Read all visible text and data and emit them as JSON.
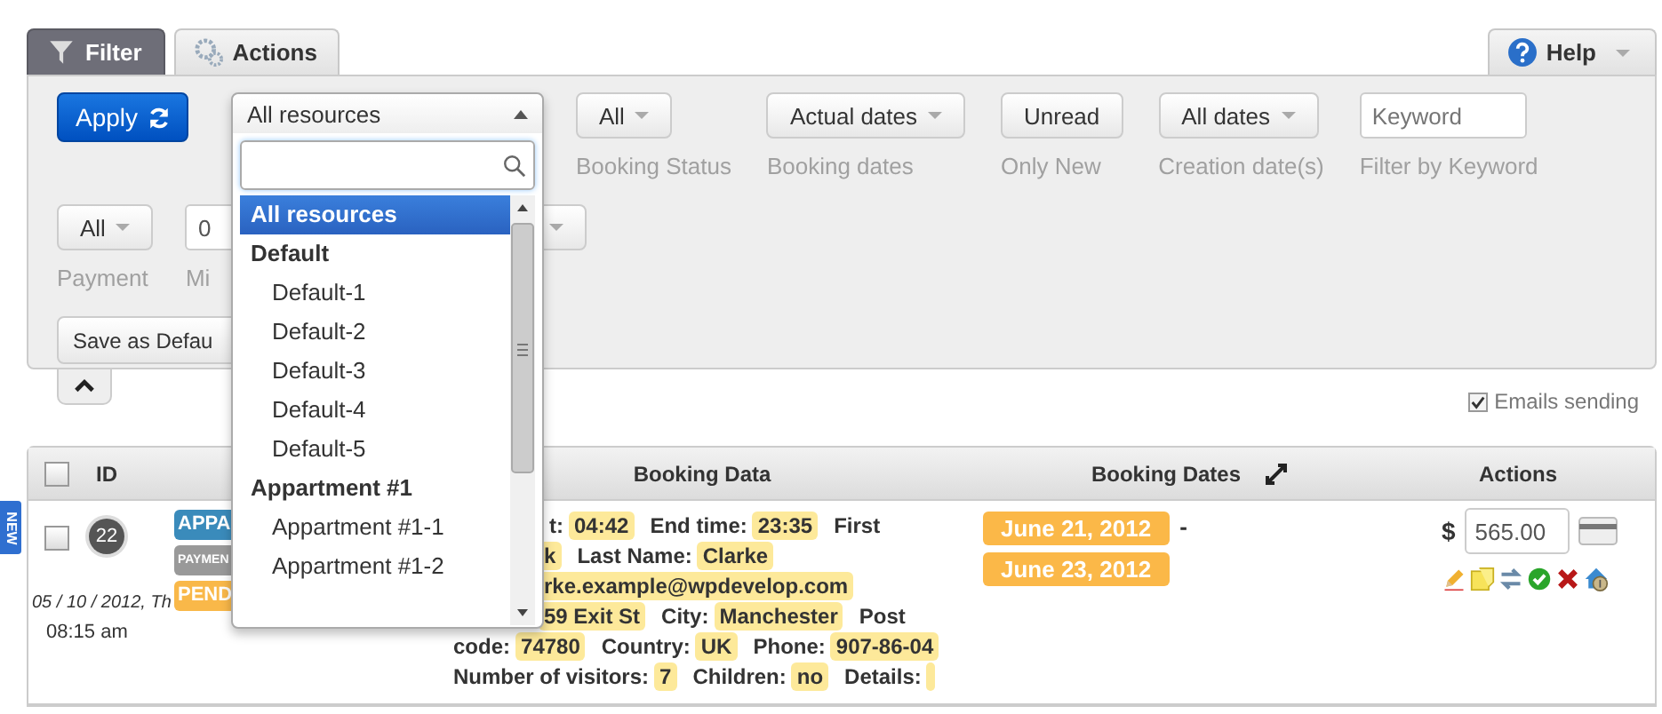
{
  "tabs": [
    {
      "label": "Filter",
      "selected": true
    },
    {
      "label": "Actions",
      "selected": false
    }
  ],
  "help_tab": {
    "label": "Help"
  },
  "filters": {
    "apply_button": "Apply",
    "row_1": [
      {
        "kind": "resource"
      },
      {
        "kind": "select",
        "value": "All",
        "label": "Booking Status"
      },
      {
        "kind": "select",
        "value": "Actual dates",
        "label": "Booking dates"
      },
      {
        "kind": "button",
        "value": "Unread",
        "label": "Only New"
      },
      {
        "kind": "select",
        "value": "All dates",
        "label": "Creation date(s)"
      },
      {
        "kind": "input",
        "placeholder": "Keyword",
        "label": "Filter by Keyword"
      }
    ],
    "row_2": [
      {
        "kind": "select",
        "value": "All",
        "label": "Payment"
      },
      {
        "kind": "input",
        "value": "0",
        "label": "Mi"
      },
      {
        "kind": "select"
      }
    ],
    "save_button": "Save as Defau"
  },
  "resource_dropdown": {
    "value": "All resources",
    "expanded": true,
    "options": [
      {
        "label": "All resources",
        "selected": true
      },
      {
        "label": "Default",
        "selected": false,
        "children": [
          {
            "label": "Default-1",
            "selected": false
          },
          {
            "label": "Default-2",
            "selected": false
          },
          {
            "label": "Default-3",
            "selected": false
          },
          {
            "label": "Default-4",
            "selected": false
          },
          {
            "label": "Default-5",
            "selected": false
          }
        ]
      },
      {
        "label": "Appartment #1",
        "selected": false,
        "children": [
          {
            "label": "Appartment #1-1",
            "selected": false
          },
          {
            "label": "Appartment #1-2",
            "selected": false
          }
        ]
      }
    ]
  },
  "emails_sending": {
    "label": "Emails sending",
    "checked": true
  },
  "table": {
    "header_checked": false,
    "columns": [
      "ID",
      "Booking Data",
      "Booking Dates",
      "Actions"
    ],
    "rows": [
      {
        "checked": false,
        "ribbon": "NEW",
        "id": "22",
        "labels": [
          {
            "text": "APPA",
            "color": "#3a8bbb"
          },
          {
            "text": "PAYMEN",
            "color": "#999999"
          },
          {
            "text": "PEND",
            "color": "#f9b849"
          }
        ],
        "created": "05 / 10 / 2012, Th",
        "time": "08:15 am",
        "data_lines": [
          [
            {
              "label": "t:",
              "value": "04:42"
            },
            {
              "label": "End time:",
              "value": "23:35"
            },
            {
              "label": "First"
            }
          ],
          [
            {
              "value": "k"
            },
            {
              "label": "Last Name:",
              "value": "Clarke"
            }
          ],
          [
            {
              "value": "rke.example@wpdevelop.com"
            }
          ],
          [
            {
              "value": "59 Exit St"
            },
            {
              "label": "City:",
              "value": "Manchester"
            },
            {
              "label": "Post"
            }
          ],
          [
            {
              "label": "code:",
              "value": "74780"
            },
            {
              "label": "Country:",
              "value": "UK"
            },
            {
              "label": "Phone:",
              "value": "907-86-04"
            }
          ],
          [
            {
              "label": "Number of visitors:",
              "value": "7"
            },
            {
              "label": "Children:",
              "value": "no"
            },
            {
              "label": "Details:",
              "blank": true
            }
          ]
        ],
        "dates": [
          "June 21, 2012",
          "June 23, 2012"
        ],
        "dates_separator": "-",
        "currency": "$",
        "cost": "565.00"
      }
    ]
  }
}
